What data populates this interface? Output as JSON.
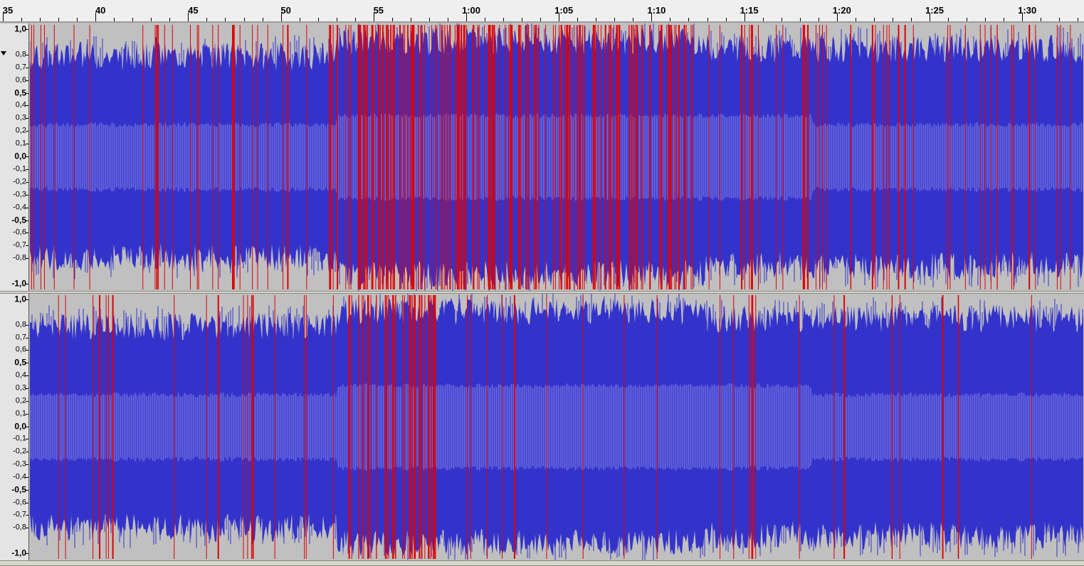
{
  "ruler": {
    "labels": [
      "35",
      "40",
      "45",
      "50",
      "55",
      "1:00",
      "1:05",
      "1:10",
      "1:15",
      "1:20",
      "1:25",
      "1:30"
    ]
  },
  "tracks": [
    {
      "scale_labels": [
        "1,0",
        "0,8",
        "0,7",
        "0,6",
        "0,5",
        "0,4",
        "0,3",
        "0,2",
        "0,1",
        "0,0",
        "-0,1",
        "-0,2",
        "-0,3",
        "-0,4",
        "-0,5",
        "-0,6",
        "-0,7",
        "-0,8",
        "-1,0"
      ],
      "scale_values": [
        1.0,
        0.8,
        0.7,
        0.6,
        0.5,
        0.4,
        0.3,
        0.2,
        0.1,
        0.0,
        -0.1,
        -0.2,
        -0.3,
        -0.4,
        -0.5,
        -0.6,
        -0.7,
        -0.8,
        -1.0
      ],
      "clip_density": "high"
    },
    {
      "scale_labels": [
        "1,0",
        "0,8",
        "0,7",
        "0,6",
        "0,5",
        "0,4",
        "0,3",
        "0,2",
        "0,1",
        "0,0",
        "-0,1",
        "-0,2",
        "-0,3",
        "-0,4",
        "-0,5",
        "-0,6",
        "-0,7",
        "-0,8",
        "-1,0"
      ],
      "scale_values": [
        1.0,
        0.8,
        0.7,
        0.6,
        0.5,
        0.4,
        0.3,
        0.2,
        0.1,
        0.0,
        -0.1,
        -0.2,
        -0.3,
        -0.4,
        -0.5,
        -0.6,
        -0.7,
        -0.8,
        -1.0
      ],
      "clip_density": "low"
    }
  ],
  "colors": {
    "waveform_peak": "#3333cc",
    "waveform_rms": "#6666dd",
    "clipping": "#e00000",
    "background": "#c0c0c0"
  }
}
